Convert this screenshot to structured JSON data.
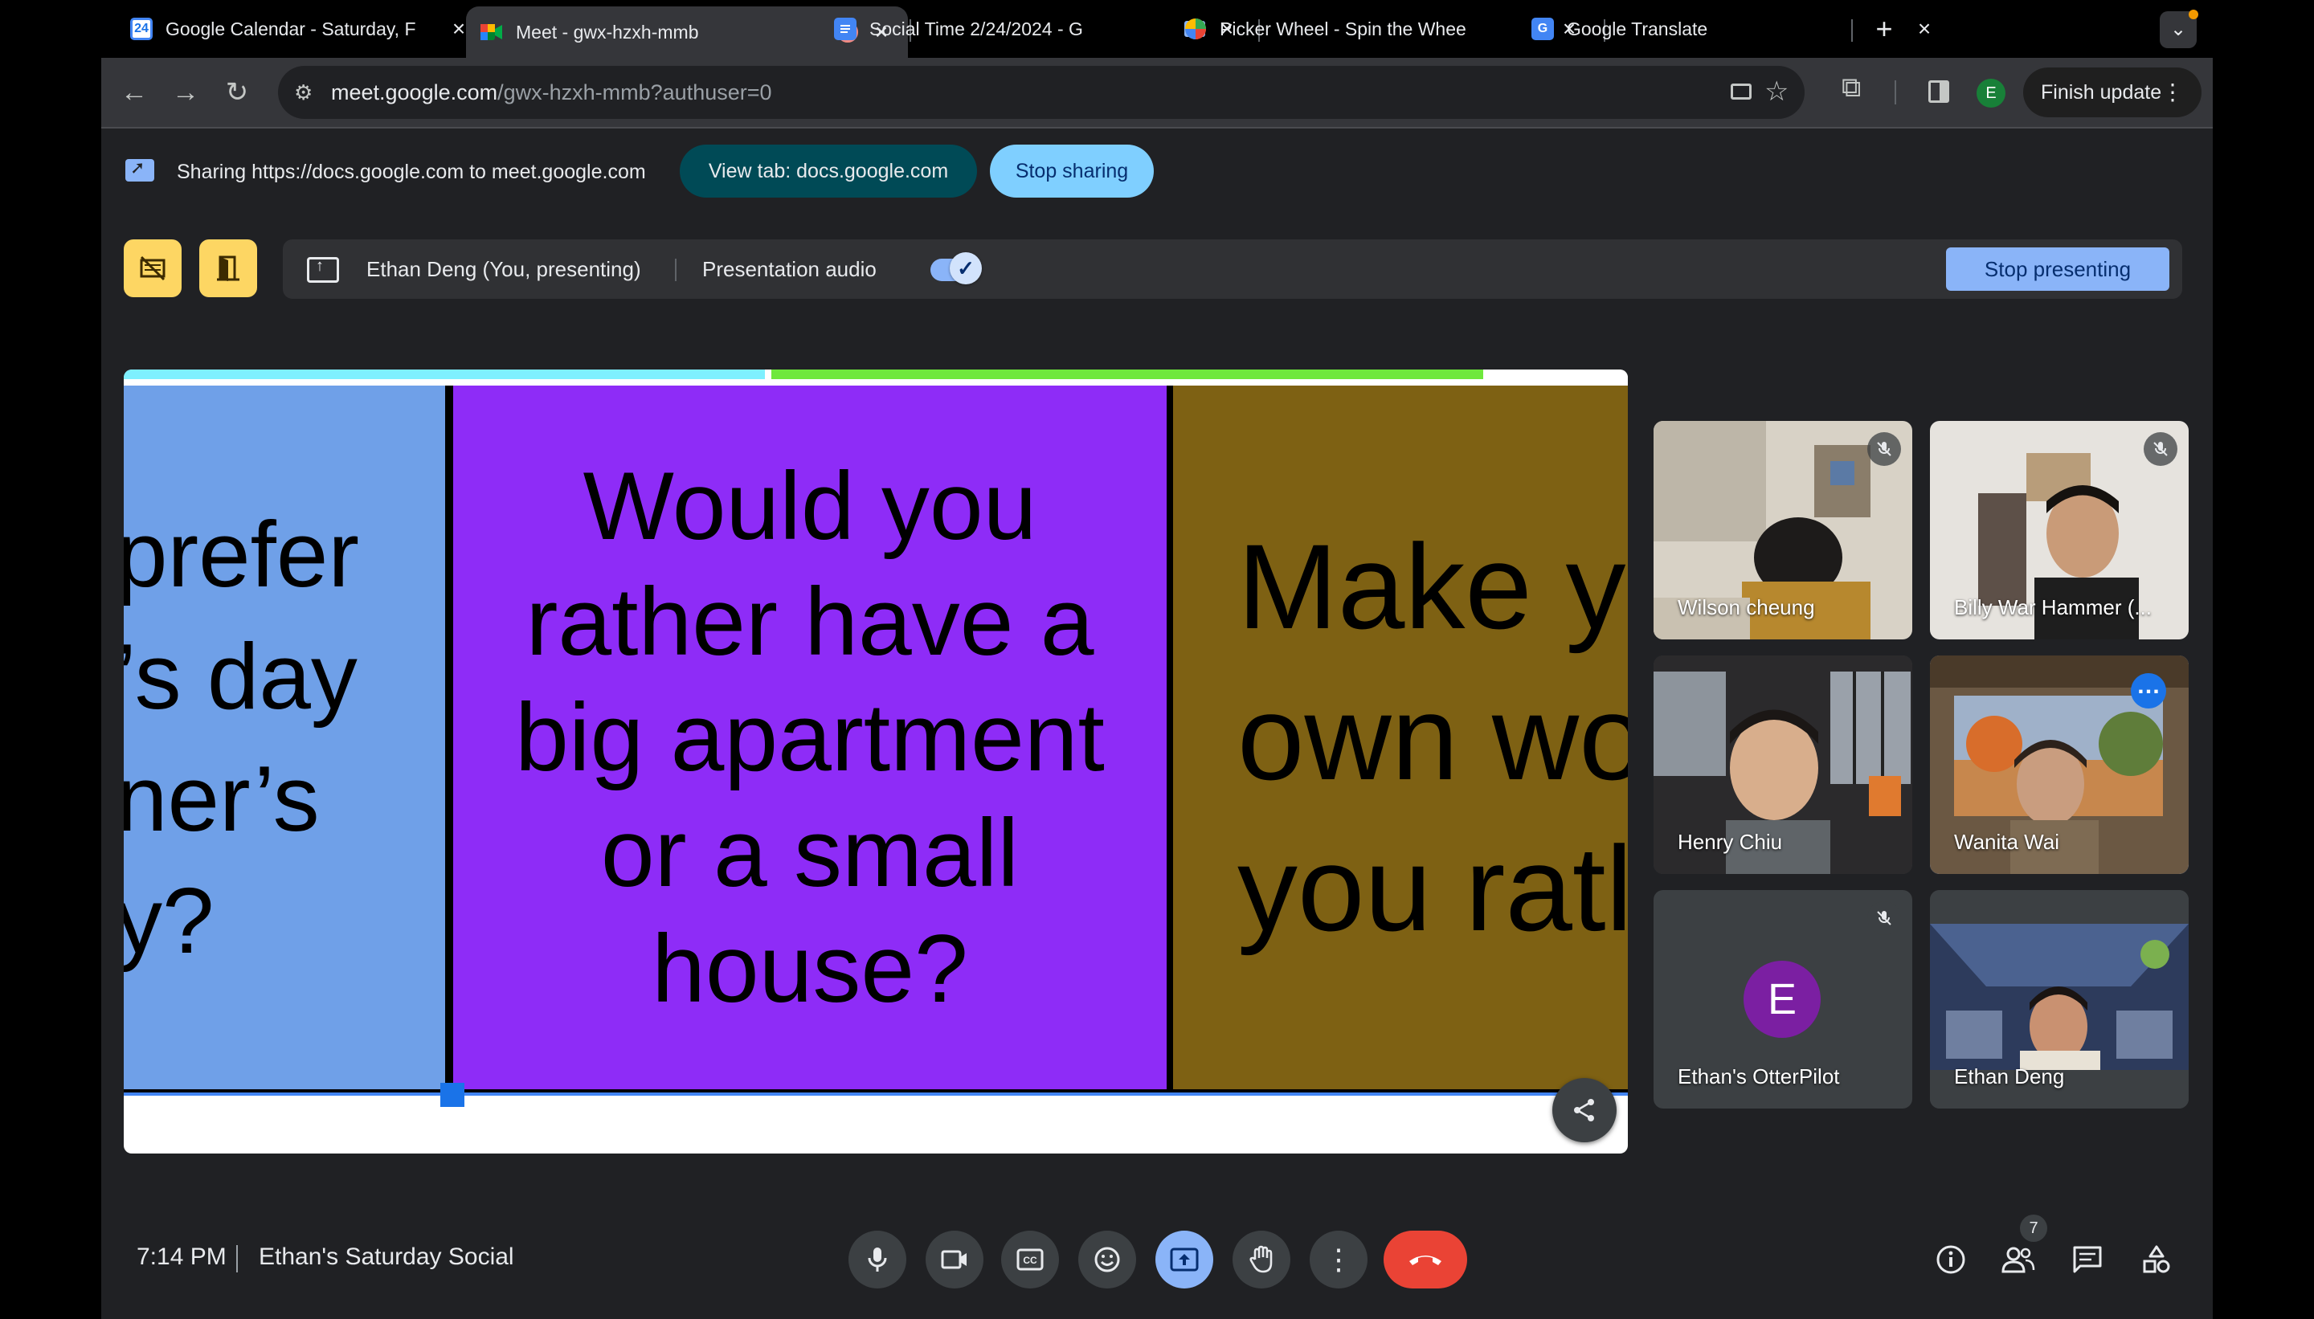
{
  "tabs": [
    {
      "title": "Google Calendar - Saturday, F",
      "favicon": "calendar-icon",
      "active": false
    },
    {
      "title": "Meet - gwx-hzxh-mmb",
      "favicon": "meet-icon",
      "active": true
    },
    {
      "title": "Social Time 2/24/2024 - G",
      "favicon": "docs-icon",
      "active": false
    },
    {
      "title": "Picker Wheel - Spin the Whee",
      "favicon": "picker-wheel-icon",
      "active": false
    },
    {
      "title": "Google Translate",
      "favicon": "translate-icon",
      "active": false
    }
  ],
  "calendar_favicon_text": "24",
  "translate_favicon_text": "G",
  "toolbar": {
    "url_host": "meet.google.com",
    "url_path": "/gwx-hzxh-mmb?authuser=0",
    "profile_initial": "E",
    "finish_update_label": "Finish update"
  },
  "sharing_bar": {
    "text": "Sharing https://docs.google.com to meet.google.com",
    "view_tab_label": "View tab: docs.google.com",
    "stop_sharing_label": "Stop sharing"
  },
  "presenting_bar": {
    "presenter": "Ethan Deng (You, presenting)",
    "presentation_audio_label": "Presentation audio",
    "presentation_audio_on": true,
    "stop_presenting_label": "Stop presenting"
  },
  "slide": {
    "left_card_text": "prefer\n’s day\nner’s\ny?",
    "center_card_text": "Would you\nrather have a\nbig apartment\nor a small\nhouse?",
    "right_card_text": "Make y\nown wo\nyou ratl",
    "colors": {
      "left": "#6fa0e8",
      "center": "#8e2cf7",
      "right": "#7e6113",
      "accent": "#1a73e8"
    }
  },
  "participants": [
    {
      "name": "Wilson cheung",
      "muted": true
    },
    {
      "name": "Billy War Hammer (...",
      "muted": true
    },
    {
      "name": "Henry Chiu",
      "muted": false
    },
    {
      "name": "Wanita Wai",
      "muted": false,
      "speaking": true
    },
    {
      "name": "Ethan's OtterPilot",
      "muted": true,
      "avatar_initial": "E"
    },
    {
      "name": "Ethan Deng",
      "muted": false
    }
  ],
  "meeting": {
    "time": "7:14 PM",
    "title": "Ethan's Saturday Social",
    "participant_count": "7"
  }
}
